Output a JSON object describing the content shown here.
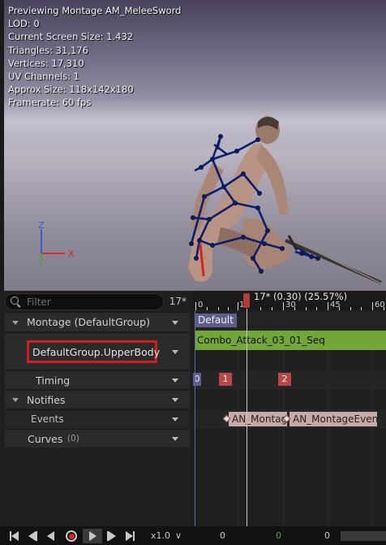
{
  "viewport": {
    "stats": [
      "Previewing Montage AM_MeleeSword",
      "LOD: 0",
      "Current Screen Size: 1.432",
      "Triangles: 31,176",
      "Vertices: 17,310",
      "UV Channels: 1",
      "Approx Size: 118x142x180",
      "Framerate: 60 fps"
    ],
    "axis": {
      "z": "Z",
      "x": "X",
      "y": "Y"
    }
  },
  "track_list": {
    "filter_placeholder": "Filter",
    "frame_count": "17*",
    "montage_label": "Montage (DefaultGroup)",
    "slot_label": "DefaultGroup.UpperBody",
    "timing_label": "Timing",
    "notifies_label": "Notifies",
    "events_label": "Events",
    "curves_label": "Curves",
    "curves_count": "(0)"
  },
  "timeline": {
    "frame_readout": "17* (0.30) (25.57%)",
    "ticks": [
      "0",
      "15",
      "30",
      "45",
      "60"
    ],
    "section_label": "Default",
    "sequence_name": "Combo_Attack_03_01_Seq",
    "timing_markers": [
      "0",
      "1",
      "2"
    ],
    "notify_1": "AN_Montag",
    "notify_2": "AN_MontageEvent"
  },
  "transport": {
    "speed": "x1.0",
    "speed_arrow": "∨",
    "start_frame": "0",
    "current_frame": "0",
    "end_frame": "0"
  },
  "colors": {
    "slot_highlight": "#d21d1d",
    "sequence_bar": "#72a636",
    "section_chip": "#5f5d8c",
    "notify_bar": "#c9a9a5",
    "timing_chip": "#b84848"
  }
}
